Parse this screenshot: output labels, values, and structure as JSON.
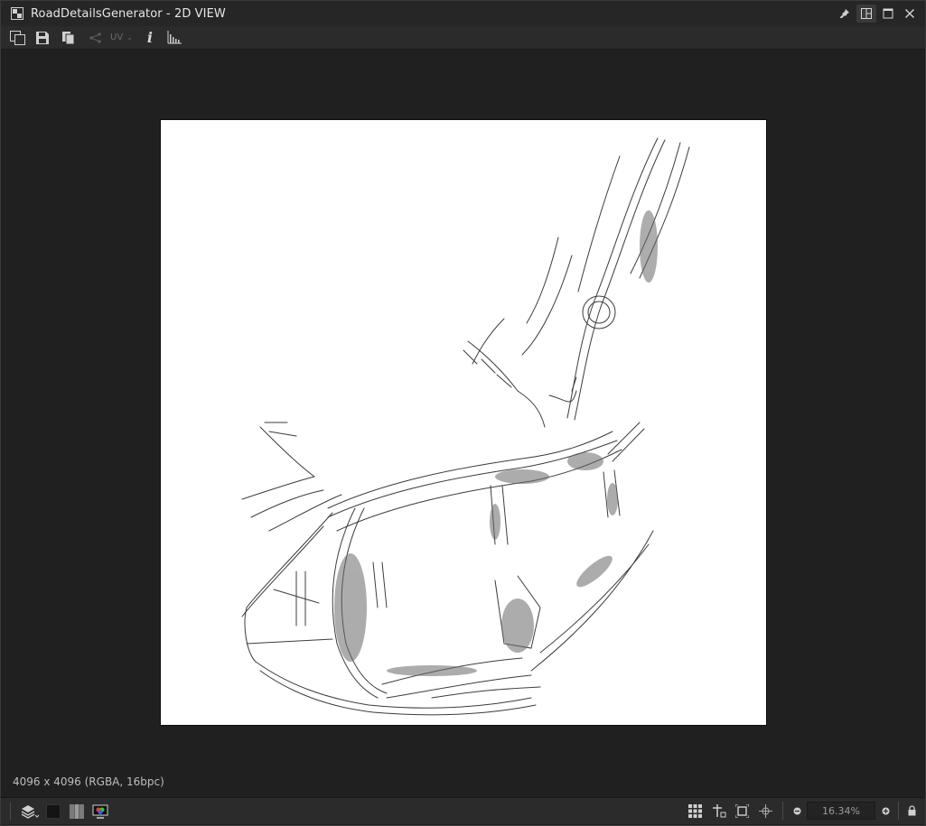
{
  "window": {
    "title": "RoadDetailsGenerator - 2D VIEW"
  },
  "toolbar": {
    "uv_label": "UV"
  },
  "viewport": {
    "image_info": "4096 x 4096 (RGBA, 16bpc)",
    "background": "#202020",
    "canvas_color": "#ffffff"
  },
  "bottombar": {
    "zoom_value": "16.34%"
  },
  "icons": {
    "title": "substance-graph-icon",
    "pin": "pin-icon",
    "layout": "layout-icon",
    "maximize": "maximize-icon",
    "close": "close-icon"
  }
}
